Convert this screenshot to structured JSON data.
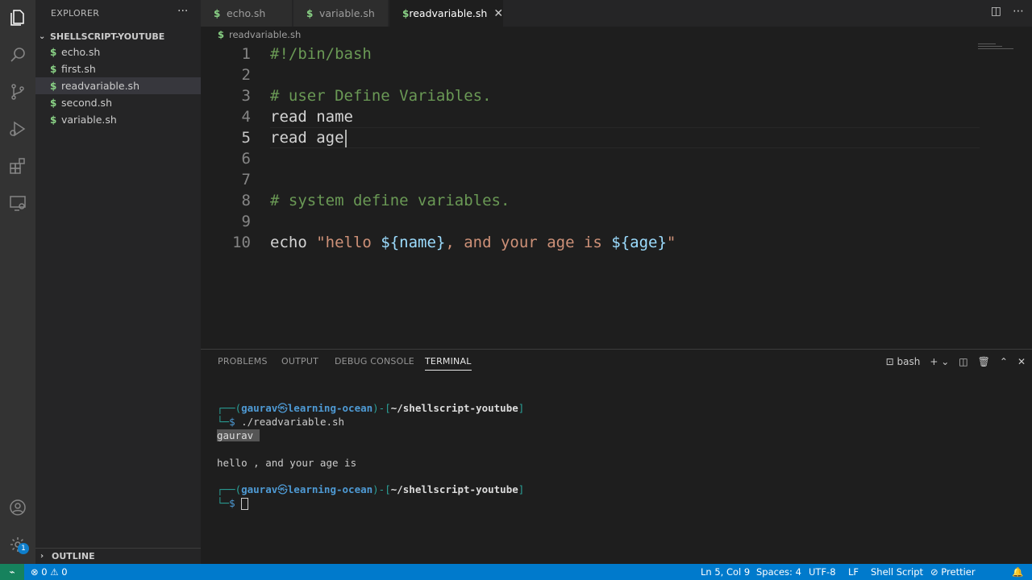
{
  "activity_bar": {
    "icons": [
      "files-icon",
      "search-icon",
      "source-control-icon",
      "run-debug-icon",
      "extensions-icon",
      "remote-explorer-icon",
      "account-icon",
      "settings-gear-icon"
    ],
    "settings_badge": "1"
  },
  "sidebar": {
    "title": "EXPLORER",
    "more_icon": "···",
    "folder": "SHELLSCRIPT-YOUTUBE",
    "files": [
      {
        "icon": "$",
        "name": "echo.sh"
      },
      {
        "icon": "$",
        "name": "first.sh"
      },
      {
        "icon": "$",
        "name": "readvariable.sh"
      },
      {
        "icon": "$",
        "name": "second.sh"
      },
      {
        "icon": "$",
        "name": "variable.sh"
      }
    ],
    "active_file_index": 2,
    "outline": "OUTLINE"
  },
  "tabs": [
    {
      "icon": "$",
      "label": "echo.sh"
    },
    {
      "icon": "$",
      "label": "variable.sh"
    },
    {
      "icon": "$",
      "label": "readvariable.sh",
      "close": "✕"
    }
  ],
  "breadcrumb": {
    "icon": "$",
    "label": "readvariable.sh"
  },
  "editor": {
    "line_numbers": [
      "1",
      "2",
      "3",
      "4",
      "5",
      "6",
      "7",
      "8",
      "9",
      "10"
    ],
    "current_line": "5",
    "lines": {
      "l1": "#!/bin/bash",
      "l3": "# user Define Variables.",
      "l4": "read name",
      "l5": "read age",
      "l8": "# system define variables.",
      "l10_cmd": "echo ",
      "l10_s1": "\"hello ",
      "l10_v1": "${name}",
      "l10_s2": ", and your age is ",
      "l10_v2": "${age}",
      "l10_s3": "\""
    }
  },
  "panel": {
    "tabs": [
      "PROBLEMS",
      "OUTPUT",
      "DEBUG CONSOLE",
      "TERMINAL"
    ],
    "active_tab": "TERMINAL",
    "shell": "bash",
    "terminal": {
      "p1_open": "┌──(",
      "user": "gaurav",
      "at": "㉿",
      "host": "learning-ocean",
      "p1_mid": ")-[",
      "path": "~/shellscript-youtube",
      "p1_close": "]",
      "p2": "└─",
      "dollar": "$",
      "cmd": " ./readvariable.sh",
      "input": "gaurav ",
      "output": "hello , and your age is"
    }
  },
  "status": {
    "remote": "⌁",
    "problems": "⊗ 0 ⚠ 0",
    "position": "Ln 5, Col 9",
    "spaces": "Spaces: 4",
    "encoding": "UTF-8",
    "eol": "LF",
    "language": "Shell Script",
    "prettier": "⊘ Prettier",
    "notifications_icon": "bell-icon"
  },
  "colors": {
    "accent": "#007acc",
    "comment": "#6a9955",
    "string": "#ce9178",
    "variable": "#9cdcfe",
    "shell_icon": "#89d185"
  }
}
